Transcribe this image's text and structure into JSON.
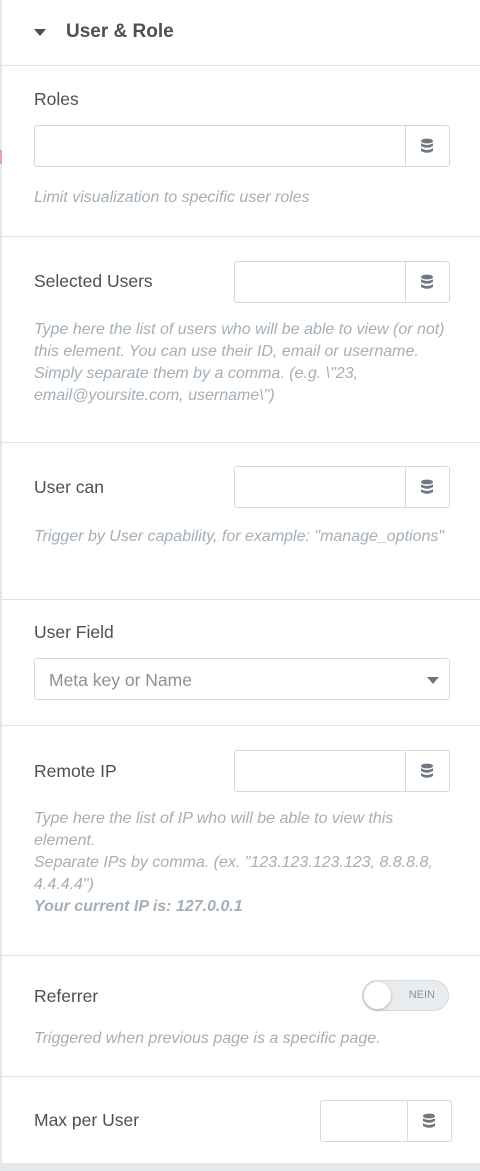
{
  "header": {
    "title": "User & Role"
  },
  "roles": {
    "label": "Roles",
    "value": "",
    "description": "Limit visualization to specific user roles"
  },
  "selected_users": {
    "label": "Selected Users",
    "value": "",
    "description": "Type here the list of users who will be able to view (or not) this element. You can use their ID, email or username. Simply separate them by a comma. (e.g. \\\"23, email@yoursite.com, username\\\")"
  },
  "user_can": {
    "label": "User can",
    "value": "",
    "description": "Trigger by User capability, for example: \"manage_options\""
  },
  "user_field": {
    "label": "User Field",
    "placeholder": "Meta key or Name"
  },
  "remote_ip": {
    "label": "Remote IP",
    "value": "",
    "description_line1": "Type here the list of IP who will be able to view this element.",
    "description_line2": "Separate IPs by comma. (ex. \"123.123.123.123, 8.8.8.8, 4.4.4.4\")",
    "current_ip": "Your current IP is: 127.0.0.1"
  },
  "referrer": {
    "label": "Referrer",
    "toggle_label": "NEIN",
    "toggle_on": false,
    "description": "Triggered when previous page is a specific page."
  },
  "max_per_user": {
    "label": "Max per User",
    "value": ""
  },
  "icons": {
    "collapse": "caret-down-icon",
    "dynamic_tags": "database-icon",
    "dropdown": "caret-down-icon"
  }
}
